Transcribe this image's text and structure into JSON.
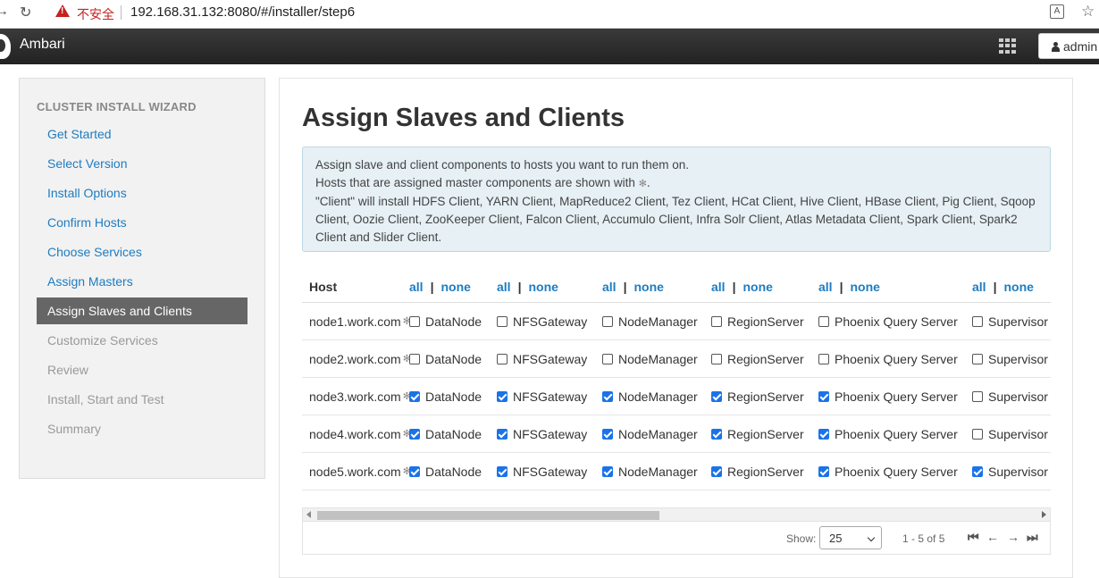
{
  "browser": {
    "insecure_label": "不安全",
    "url": "192.168.31.132:8080/#/installer/step6",
    "translate_label": "A"
  },
  "topnav": {
    "brand": "Ambari",
    "user_label": "admin"
  },
  "sidebar": {
    "heading": "CLUSTER INSTALL WIZARD",
    "items": [
      {
        "label": "Get Started",
        "state": "link"
      },
      {
        "label": "Select Version",
        "state": "link"
      },
      {
        "label": "Install Options",
        "state": "link"
      },
      {
        "label": "Confirm Hosts",
        "state": "link"
      },
      {
        "label": "Choose Services",
        "state": "link"
      },
      {
        "label": "Assign Masters",
        "state": "link"
      },
      {
        "label": "Assign Slaves and Clients",
        "state": "active"
      },
      {
        "label": "Customize Services",
        "state": "disabled"
      },
      {
        "label": "Review",
        "state": "disabled"
      },
      {
        "label": "Install, Start and Test",
        "state": "disabled"
      },
      {
        "label": "Summary",
        "state": "disabled"
      }
    ]
  },
  "main": {
    "title": "Assign Slaves and Clients",
    "alert": {
      "line1": "Assign slave and client components to hosts you want to run them on.",
      "line2": "Hosts that are assigned master components are shown with",
      "line2_end": ".",
      "line3": "\"Client\" will install HDFS Client, YARN Client, MapReduce2 Client, Tez Client, HCat Client, Hive Client, HBase Client, Pig Client, Sqoop Client, Oozie Client, ZooKeeper Client, Falcon Client, Accumulo Client, Infra Solr Client, Atlas Metadata Client, Spark Client, Spark2 Client and Slider Client."
    },
    "star_glyph": "✻",
    "table": {
      "host_header": "Host",
      "all_label": "all",
      "none_label": "none",
      "bar": "|",
      "columns": [
        "DataNode",
        "NFSGateway",
        "NodeManager",
        "RegionServer",
        "Phoenix Query Server",
        "Supervisor"
      ],
      "rows": [
        {
          "host": "node1.work.com",
          "checks": [
            false,
            false,
            false,
            false,
            false,
            false
          ]
        },
        {
          "host": "node2.work.com",
          "checks": [
            false,
            false,
            false,
            false,
            false,
            false
          ]
        },
        {
          "host": "node3.work.com",
          "checks": [
            true,
            true,
            true,
            true,
            true,
            false
          ]
        },
        {
          "host": "node4.work.com",
          "checks": [
            true,
            true,
            true,
            true,
            true,
            false
          ]
        },
        {
          "host": "node5.work.com",
          "checks": [
            true,
            true,
            true,
            true,
            true,
            true
          ]
        }
      ]
    },
    "pager": {
      "show_label": "Show:",
      "page_size": "25",
      "range": "1 - 5 of 5",
      "first": "⏮",
      "prev": "←",
      "next": "→",
      "last": "⏭"
    }
  }
}
